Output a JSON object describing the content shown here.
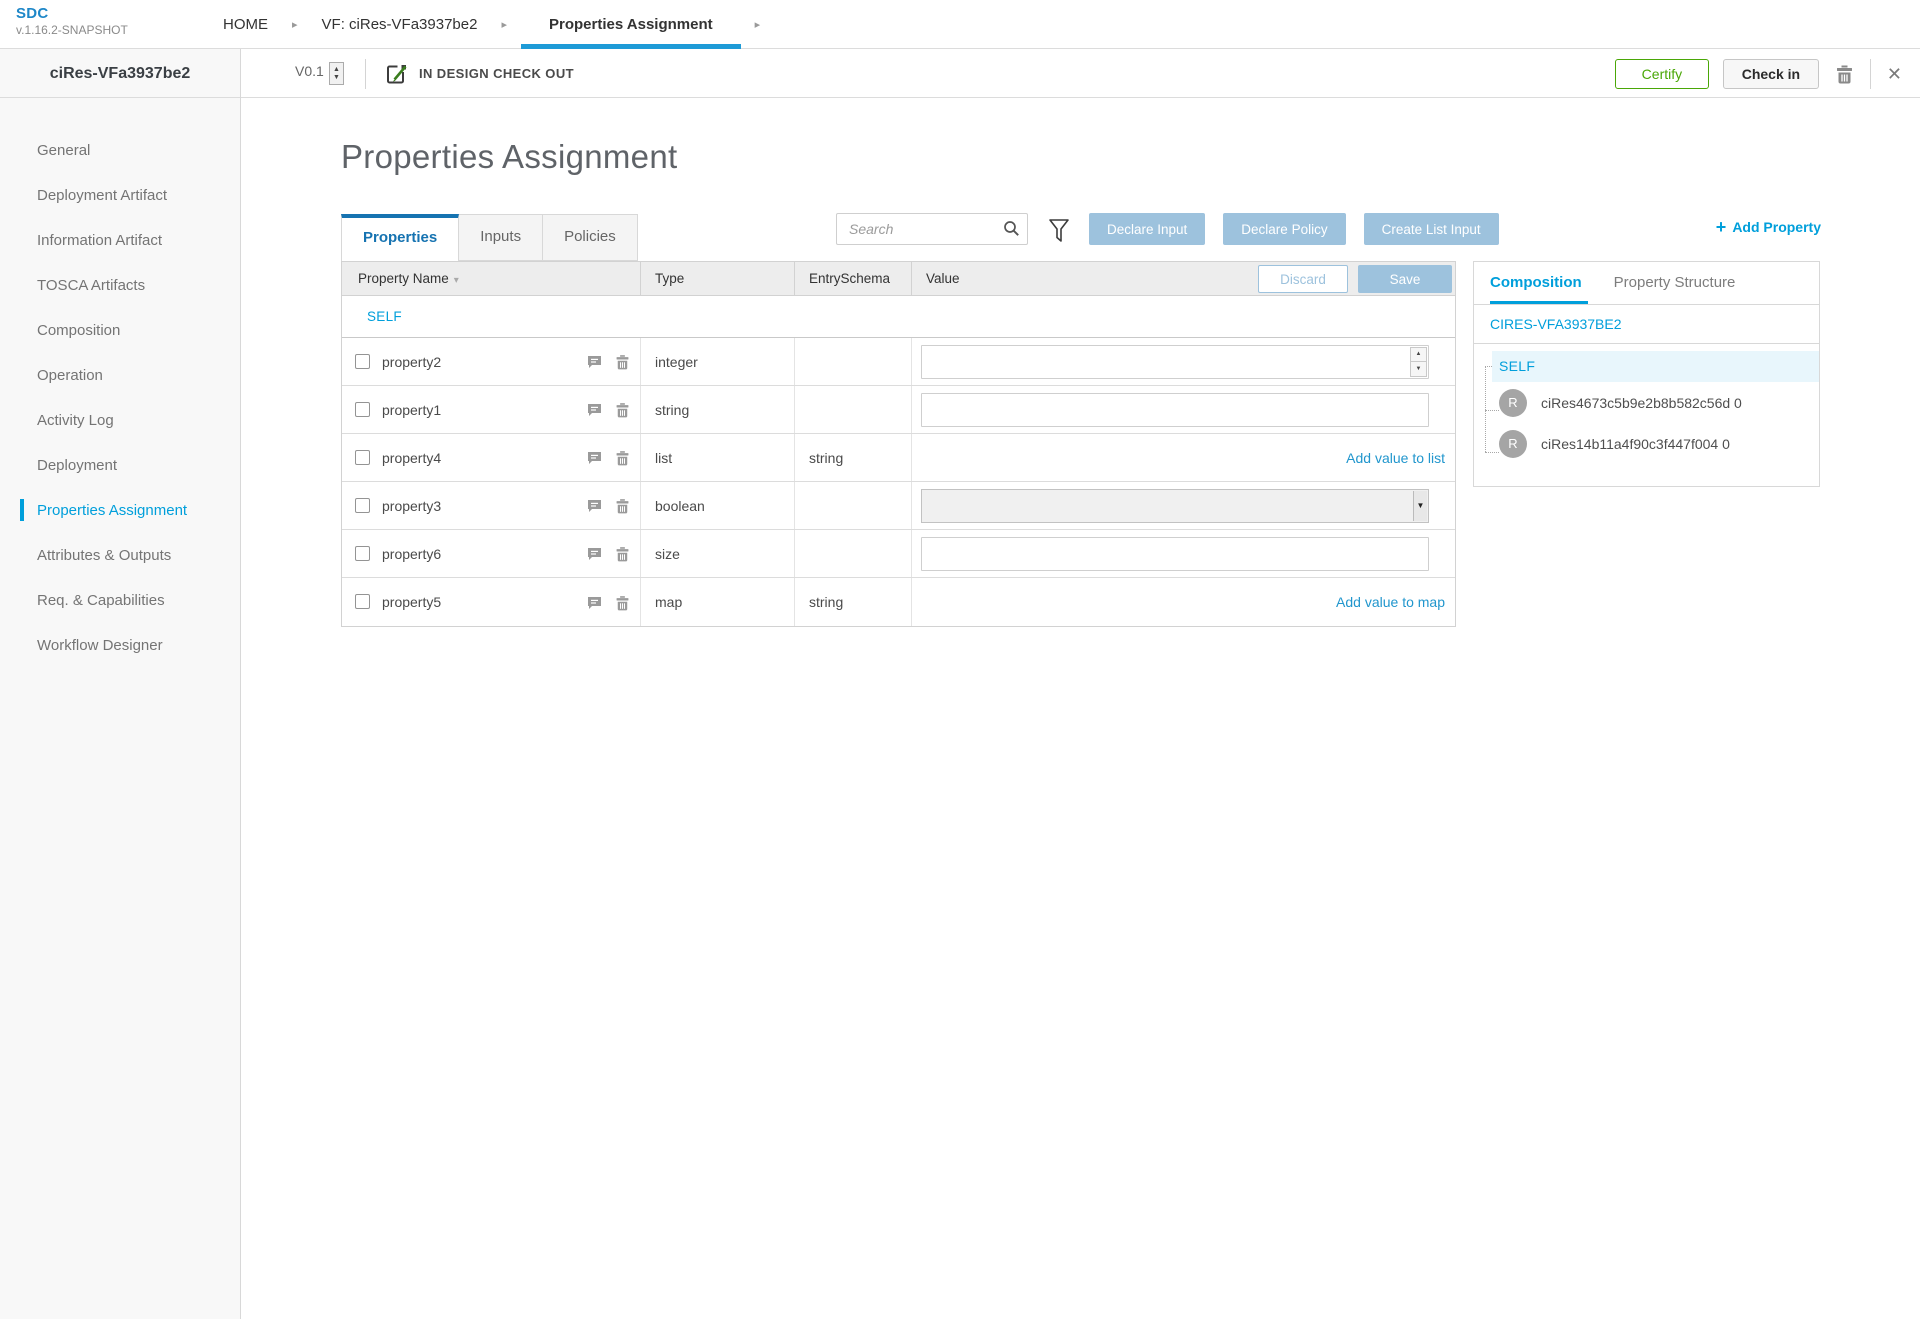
{
  "icons": {
    "breadcrumb_arrow": "▸",
    "sort_caret": "▾",
    "close": "✕",
    "plus": "+",
    "spin_up": "▲",
    "spin_down": "▼",
    "select_arrow": "▼"
  },
  "colors": {
    "accent": "#009fdb",
    "tab_blue": "#1673b1",
    "button_blue": "#9dc2dd",
    "certify_green": "#4aa707",
    "sidebar_bg": "#f8f8f8",
    "self_highlight": "#e8f6fc"
  },
  "header": {
    "logo_title": "SDC",
    "logo_version": "v.1.16.2-SNAPSHOT",
    "breadcrumbs": [
      {
        "label": "HOME",
        "active": false
      },
      {
        "label": "VF: ciRes-VFa3937be2",
        "active": false
      },
      {
        "label": "Properties Assignment",
        "active": true
      }
    ]
  },
  "subheader": {
    "version": "V0.1",
    "status": "IN DESIGN CHECK OUT",
    "certify_label": "Certify",
    "checkin_label": "Check in"
  },
  "sidebar": {
    "title": "ciRes-VFa3937be2",
    "items": [
      {
        "label": "General",
        "active": false
      },
      {
        "label": "Deployment Artifact",
        "active": false
      },
      {
        "label": "Information Artifact",
        "active": false
      },
      {
        "label": "TOSCA Artifacts",
        "active": false
      },
      {
        "label": "Composition",
        "active": false
      },
      {
        "label": "Operation",
        "active": false
      },
      {
        "label": "Activity Log",
        "active": false
      },
      {
        "label": "Deployment",
        "active": false
      },
      {
        "label": "Properties Assignment",
        "active": true
      },
      {
        "label": "Attributes & Outputs",
        "active": false
      },
      {
        "label": "Req. & Capabilities",
        "active": false
      },
      {
        "label": "Workflow Designer",
        "active": false
      }
    ]
  },
  "main": {
    "title": "Properties Assignment",
    "tabs": [
      {
        "label": "Properties",
        "active": true
      },
      {
        "label": "Inputs",
        "active": false
      },
      {
        "label": "Policies",
        "active": false
      }
    ],
    "search_placeholder": "Search",
    "search_value": "",
    "action_buttons": [
      "Declare Input",
      "Declare Policy",
      "Create List Input"
    ],
    "add_property_label": "Add Property",
    "table": {
      "columns": [
        "Property Name",
        "Type",
        "EntrySchema",
        "Value"
      ],
      "discard_label": "Discard",
      "save_label": "Save",
      "group_label": "SELF",
      "rows": [
        {
          "name": "property2",
          "type": "integer",
          "entry_schema": "",
          "value_kind": "number",
          "value": ""
        },
        {
          "name": "property1",
          "type": "string",
          "entry_schema": "",
          "value_kind": "text",
          "value": ""
        },
        {
          "name": "property4",
          "type": "list",
          "entry_schema": "string",
          "value_kind": "link",
          "link_label": "Add value to list"
        },
        {
          "name": "property3",
          "type": "boolean",
          "entry_schema": "",
          "value_kind": "select",
          "value": ""
        },
        {
          "name": "property6",
          "type": "size",
          "entry_schema": "",
          "value_kind": "text",
          "value": ""
        },
        {
          "name": "property5",
          "type": "map",
          "entry_schema": "string",
          "value_kind": "link",
          "link_label": "Add value to map"
        }
      ]
    }
  },
  "right_panel": {
    "tabs": [
      {
        "label": "Composition",
        "active": true
      },
      {
        "label": "Property Structure",
        "active": false
      }
    ],
    "component_name": "CIRES-VFA3937BE2",
    "tree": {
      "self_label": "SELF",
      "items": [
        {
          "avatar": "R",
          "label": "ciRes4673c5b9e2b8b582c56d 0"
        },
        {
          "avatar": "R",
          "label": "ciRes14b11a4f90c3f447f004 0"
        }
      ]
    }
  }
}
